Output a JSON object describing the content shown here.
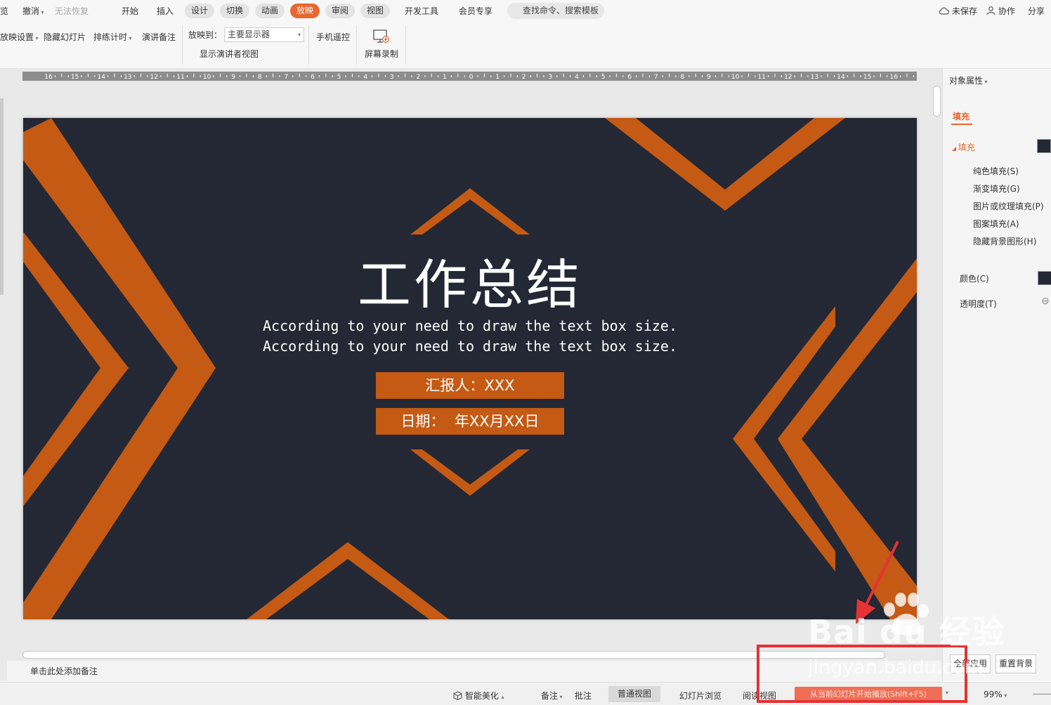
{
  "menubar": {
    "preview_label": "览",
    "undo_label": "撤消",
    "redo_label": "无法恢复",
    "tabs": [
      {
        "label": "开始"
      },
      {
        "label": "插入"
      },
      {
        "label": "设计"
      },
      {
        "label": "切换"
      },
      {
        "label": "动画"
      },
      {
        "label": "放映"
      },
      {
        "label": "审阅"
      },
      {
        "label": "视图"
      },
      {
        "label": "开发工具"
      },
      {
        "label": "会员专享"
      }
    ],
    "active_tab": "放映",
    "search_label": "查找命令、搜索模板",
    "unsaved_label": "未保存",
    "collab_label": "协作",
    "share_label": "分享"
  },
  "ribbon": {
    "show_settings_label": "放映设置",
    "hide_slide_label": "隐藏幻灯片",
    "rehearse_label": "排练计时",
    "speaker_notes_label": "演讲备注",
    "show_to_label": "放映到：",
    "display_value": "主要显示器",
    "presenter_view_label": "显示演讲者视图",
    "phone_remote_label": "手机遥控",
    "screen_record_label": "屏幕录制"
  },
  "ruler": {
    "labels": [
      "16",
      "15",
      "14",
      "13",
      "12",
      "11",
      "10",
      "9",
      "8",
      "7",
      "6",
      "5",
      "4",
      "3",
      "2",
      "1",
      "0",
      "1",
      "2",
      "3",
      "4",
      "5",
      "6",
      "7",
      "8",
      "9",
      "10",
      "11",
      "12",
      "13",
      "14",
      "15",
      "16"
    ]
  },
  "slide": {
    "title": "工作总结",
    "subtitle_line1": "According to your need to draw the text box size.",
    "subtitle_line2": "According to your need to draw the text box size.",
    "reporter": "汇报人：XXX",
    "date": "日期：  年XX月XX日",
    "background_color": "#232834",
    "accent_color": "#c45a14"
  },
  "notes": {
    "placeholder": "单击此处添加备注"
  },
  "right_panel": {
    "title": "对象属性",
    "tab_fill": "填充",
    "section_fill": "填充",
    "options": [
      {
        "label": "纯色填充(S)"
      },
      {
        "label": "渐变填充(G)"
      },
      {
        "label": "图片或纹理填充(P)"
      },
      {
        "label": "图案填充(A)"
      },
      {
        "label": "隐藏背景图形(H)"
      }
    ],
    "color_label": "颜色(C)",
    "transparency_label": "透明度(T)",
    "apply_all_label": "全部应用",
    "reset_bg_label": "重置背景"
  },
  "statusbar": {
    "beautify_label": "智能美化",
    "notes_label": "备注",
    "comment_label": "批注",
    "normal_view_label": "普通视图",
    "slide_sorter_label": "幻灯片浏览",
    "reading_view_label": "阅读视图",
    "play_label": "从当前幻灯片开始播放(Shift+F5)",
    "zoom_label": "99%"
  },
  "watermark": {
    "brand": "Bai du 经验",
    "url": "jingyan.baidu.com"
  },
  "colors": {
    "accent_tab": "#e8662f",
    "annotation_red": "#e53233"
  }
}
